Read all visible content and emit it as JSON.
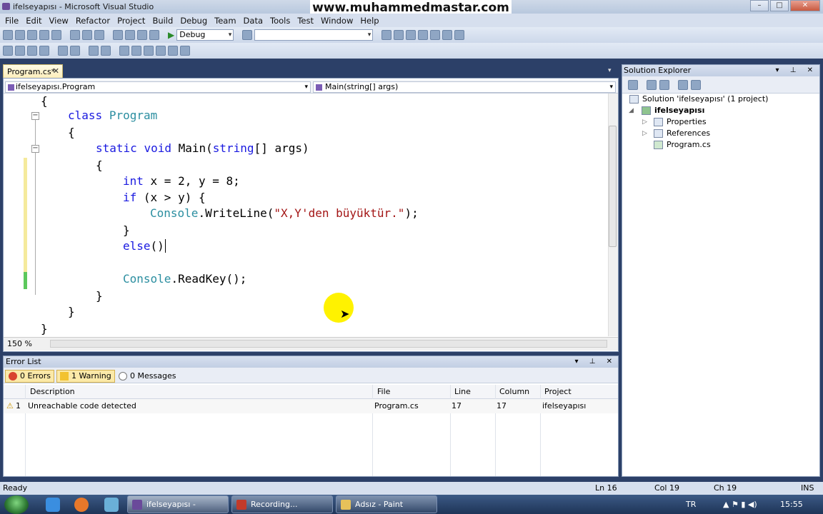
{
  "window": {
    "title": "ifelseyapısı - Microsoft Visual Studio",
    "watermark": "www.muhammedmastar.com"
  },
  "menu": [
    "File",
    "Edit",
    "View",
    "Refactor",
    "Project",
    "Build",
    "Debug",
    "Team",
    "Data",
    "Tools",
    "Test",
    "Window",
    "Help"
  ],
  "toolbar": {
    "config": "Debug",
    "find_value": ""
  },
  "editor": {
    "tab": "Program.cs*",
    "class_dropdown": "ifelseyapısı.Program",
    "member_dropdown": "Main(string[] args)",
    "zoom": "150 %",
    "lines": [
      {
        "indent": "",
        "text": "{"
      },
      {
        "indent": "    ",
        "kw": "class",
        "ty": "Program",
        "text": ""
      },
      {
        "indent": "    ",
        "text": "{"
      },
      {
        "indent": "        ",
        "text": "static void Main(string[] args)"
      },
      {
        "indent": "        ",
        "text": "{"
      },
      {
        "indent": "            ",
        "text": "int x = 2, y = 8;"
      },
      {
        "indent": "            ",
        "text": "if (x > y) {"
      },
      {
        "indent": "                ",
        "text": "Console.WriteLine(\"X,Y'den büyüktür.\");"
      },
      {
        "indent": "            ",
        "text": "}"
      },
      {
        "indent": "            ",
        "text": "else()"
      },
      {
        "indent": "",
        "text": ""
      },
      {
        "indent": "            ",
        "text": "Console.ReadKey();"
      },
      {
        "indent": "        ",
        "text": "}"
      },
      {
        "indent": "    ",
        "text": "}"
      },
      {
        "indent": "",
        "text": "}"
      }
    ]
  },
  "error_list": {
    "title": "Error List",
    "errors_btn": "0 Errors",
    "warnings_btn": "1 Warning",
    "messages_btn": "0 Messages",
    "columns": [
      "Description",
      "File",
      "Line",
      "Column",
      "Project"
    ],
    "rows": [
      {
        "num": "1",
        "description": "Unreachable code detected",
        "file": "Program.cs",
        "line": "17",
        "column": "17",
        "project": "ifelseyapısı"
      }
    ]
  },
  "solution_explorer": {
    "title": "Solution Explorer",
    "solution": "Solution 'ifelseyapısı' (1 project)",
    "project": "ifelseyapısı",
    "items": [
      "Properties",
      "References",
      "Program.cs"
    ]
  },
  "status": {
    "text": "Ready",
    "ln": "Ln 16",
    "col": "Col 19",
    "ch": "Ch 19",
    "mode": "INS"
  },
  "taskbar": {
    "buttons": [
      "ifelseyapısı - Microso...",
      "Recording...",
      "Adsız - Paint"
    ],
    "lang": "TR",
    "clock": "15:55"
  }
}
